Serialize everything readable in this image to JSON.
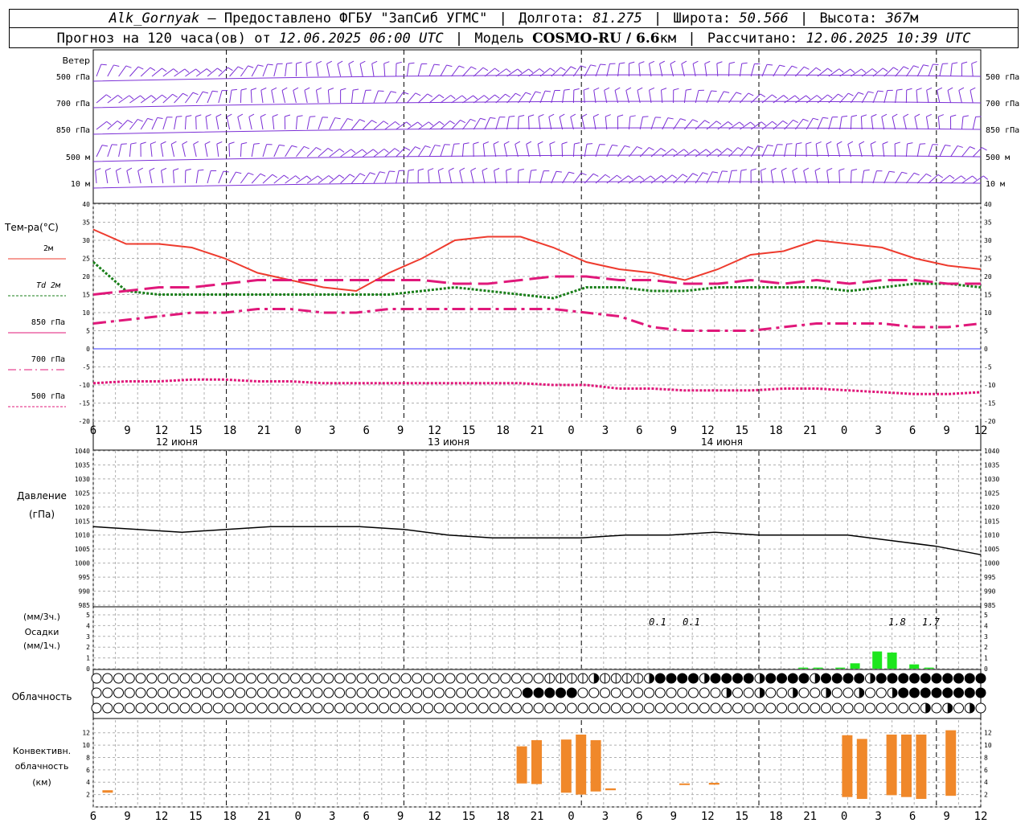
{
  "header": {
    "station": "Alk_Gornyak",
    "provider": "– Предоставлено ФГБУ \"ЗапСиб УГМС\"",
    "lon_label": "Долгота:",
    "lon_value": "81.275",
    "lat_label": "Широта:",
    "lat_value": "50.566",
    "alt_label": "Высота:",
    "alt_value": "367",
    "alt_unit": "м",
    "forecast_prefix": "Прогноз на 120 часа(ов) от",
    "forecast_start": "12.06.2025 06:00 UTC",
    "model_label": "Модель",
    "model_name": "COSMO-RU / 6.6",
    "model_unit": "км",
    "calc_label": "Рассчитано:",
    "calc_time": "12.06.2025 10:39 UTC"
  },
  "time_axis": {
    "hour_labels": [
      "6",
      "9",
      "12",
      "15",
      "18",
      "21",
      "0",
      "3",
      "6",
      "9",
      "12",
      "15",
      "18",
      "21",
      "0",
      "3",
      "6",
      "9",
      "12",
      "15",
      "18",
      "21",
      "0",
      "3",
      "6",
      "9",
      "12"
    ],
    "day_labels": [
      "12 июня",
      "13 июня",
      "14 июня"
    ]
  },
  "wind_panel": {
    "title": "Ветер",
    "levels": [
      "500 гПа",
      "700 гПа",
      "850 гПа",
      "500 м",
      "10   м"
    ],
    "color": "#7b2fd6"
  },
  "temp_panel": {
    "title": "Тем-ра(°C)",
    "legend": [
      {
        "label": "2м",
        "color": "#ee3b2e"
      },
      {
        "label": "Td  2м",
        "color": "#1a7f1a"
      },
      {
        "label": "850 гПа",
        "color": "#e0187a"
      },
      {
        "label": "700 гПа",
        "color": "#e0187a"
      },
      {
        "label": "500 гПа",
        "color": "#e0187a"
      }
    ],
    "y_ticks": [
      "40",
      "35",
      "30",
      "25",
      "20",
      "15",
      "10",
      "5",
      "0",
      "-5",
      "-10",
      "-15",
      "-20"
    ]
  },
  "pressure_panel": {
    "title": "Давление",
    "unit": "(гПа)",
    "y_ticks": [
      "1040",
      "1035",
      "1030",
      "1025",
      "1020",
      "1015",
      "1010",
      "1005",
      "1000",
      "995",
      "990",
      "985"
    ]
  },
  "precip_panel": {
    "unit3": "(мм/3ч.)",
    "title": "Осадки",
    "unit1": "(мм/1ч.)",
    "y_ticks": [
      "5",
      "4",
      "3",
      "2",
      "1",
      "0"
    ],
    "annotations": [
      "0.1",
      "0.1",
      "1.8",
      "1.7"
    ],
    "color": "#1ee61e"
  },
  "cloud_panel": {
    "title": "Облачность"
  },
  "conv_panel": {
    "title1": "Конвективн.",
    "title2": "облачность",
    "unit": "(км)",
    "y_ticks": [
      "12",
      "10",
      "8",
      "6",
      "4",
      "2"
    ],
    "color": "#f0882a"
  },
  "chart_data": [
    {
      "type": "line",
      "title": "Тем-ра(°C)",
      "x_hours": [
        0,
        3,
        6,
        9,
        12,
        15,
        18,
        21,
        24,
        27,
        30,
        33,
        36,
        39,
        42,
        45,
        48,
        51,
        54,
        57,
        60,
        63,
        66,
        69,
        72,
        75,
        78,
        81
      ],
      "ylim": [
        -20,
        40
      ],
      "series": [
        {
          "name": "2м",
          "values": [
            33,
            29,
            29,
            28,
            25,
            21,
            19,
            17,
            16,
            21,
            25,
            30,
            31,
            31,
            28,
            24,
            22,
            21,
            19,
            22,
            26,
            27,
            30,
            29,
            28,
            25,
            23,
            22
          ]
        },
        {
          "name": "Td  2м",
          "values": [
            24,
            16,
            15,
            15,
            15,
            15,
            15,
            15,
            15,
            15,
            16,
            17,
            16,
            15,
            14,
            17,
            17,
            16,
            16,
            17,
            17,
            17,
            17,
            16,
            17,
            18,
            18,
            17
          ]
        },
        {
          "name": "850 гПа",
          "values": [
            15,
            16,
            17,
            17,
            18,
            19,
            19,
            19,
            19,
            19,
            19,
            18,
            18,
            19,
            20,
            20,
            19,
            19,
            18,
            18,
            19,
            18,
            19,
            18,
            19,
            19,
            18,
            18
          ]
        },
        {
          "name": "700 гПа",
          "values": [
            7,
            8,
            9,
            10,
            10,
            11,
            11,
            10,
            10,
            11,
            11,
            11,
            11,
            11,
            11,
            10,
            9,
            6,
            5,
            5,
            5,
            6,
            7,
            7,
            7,
            6,
            6,
            7
          ]
        },
        {
          "name": "500 гПа",
          "values": [
            -9.5,
            -9,
            -9,
            -8.5,
            -8.5,
            -9,
            -9,
            -9.5,
            -9.5,
            -9.5,
            -9.5,
            -9.5,
            -9.5,
            -9.5,
            -10,
            -10,
            -11,
            -11,
            -11.5,
            -11.5,
            -11.5,
            -11,
            -11,
            -11.5,
            -12,
            -12.5,
            -12.5,
            -12
          ]
        }
      ]
    },
    {
      "type": "line",
      "title": "Давление",
      "ylim": [
        985,
        1040
      ],
      "x_hours": [
        0,
        6,
        12,
        18,
        24,
        30,
        36,
        42,
        48,
        54,
        60,
        66,
        72,
        78,
        84,
        90,
        96,
        102,
        108,
        114,
        120
      ],
      "series": [
        {
          "name": "Давление",
          "values": [
            1013,
            1012,
            1011,
            1012,
            1013,
            1013,
            1013,
            1012,
            1010,
            1009,
            1009,
            1009,
            1010,
            1010,
            1011,
            1010,
            1010,
            1010,
            1008,
            1006,
            1003
          ]
        }
      ]
    },
    {
      "type": "bar",
      "title": "Осадки",
      "ylim": [
        0,
        5
      ],
      "x_hours": [
        96,
        98,
        101,
        103,
        106,
        108,
        111,
        113
      ],
      "values": [
        0.1,
        0.1,
        0.1,
        0.5,
        1.6,
        1.5,
        0.4,
        0.1
      ]
    },
    {
      "type": "bar",
      "title": "Конвективн. облачность",
      "ylim": [
        0,
        13
      ],
      "bars": [
        {
          "x_hour": 2,
          "bottom": 2.3,
          "top": 2.7
        },
        {
          "x_hour": 58,
          "bottom": 3.8,
          "top": 9.8
        },
        {
          "x_hour": 60,
          "bottom": 3.7,
          "top": 10.8
        },
        {
          "x_hour": 64,
          "bottom": 2.3,
          "top": 10.9
        },
        {
          "x_hour": 66,
          "bottom": 2.0,
          "top": 11.7
        },
        {
          "x_hour": 68,
          "bottom": 2.5,
          "top": 10.8
        },
        {
          "x_hour": 70,
          "bottom": 2.7,
          "top": 3.0
        },
        {
          "x_hour": 80,
          "bottom": 3.6,
          "top": 3.8
        },
        {
          "x_hour": 84,
          "bottom": 3.6,
          "top": 3.9
        },
        {
          "x_hour": 102,
          "bottom": 1.6,
          "top": 11.6
        },
        {
          "x_hour": 104,
          "bottom": 1.3,
          "top": 11.0
        },
        {
          "x_hour": 108,
          "bottom": 1.9,
          "top": 11.7
        },
        {
          "x_hour": 110,
          "bottom": 1.6,
          "top": 11.7
        },
        {
          "x_hour": 112,
          "bottom": 1.3,
          "top": 11.7
        },
        {
          "x_hour": 116,
          "bottom": 1.8,
          "top": 12.4
        }
      ]
    }
  ]
}
